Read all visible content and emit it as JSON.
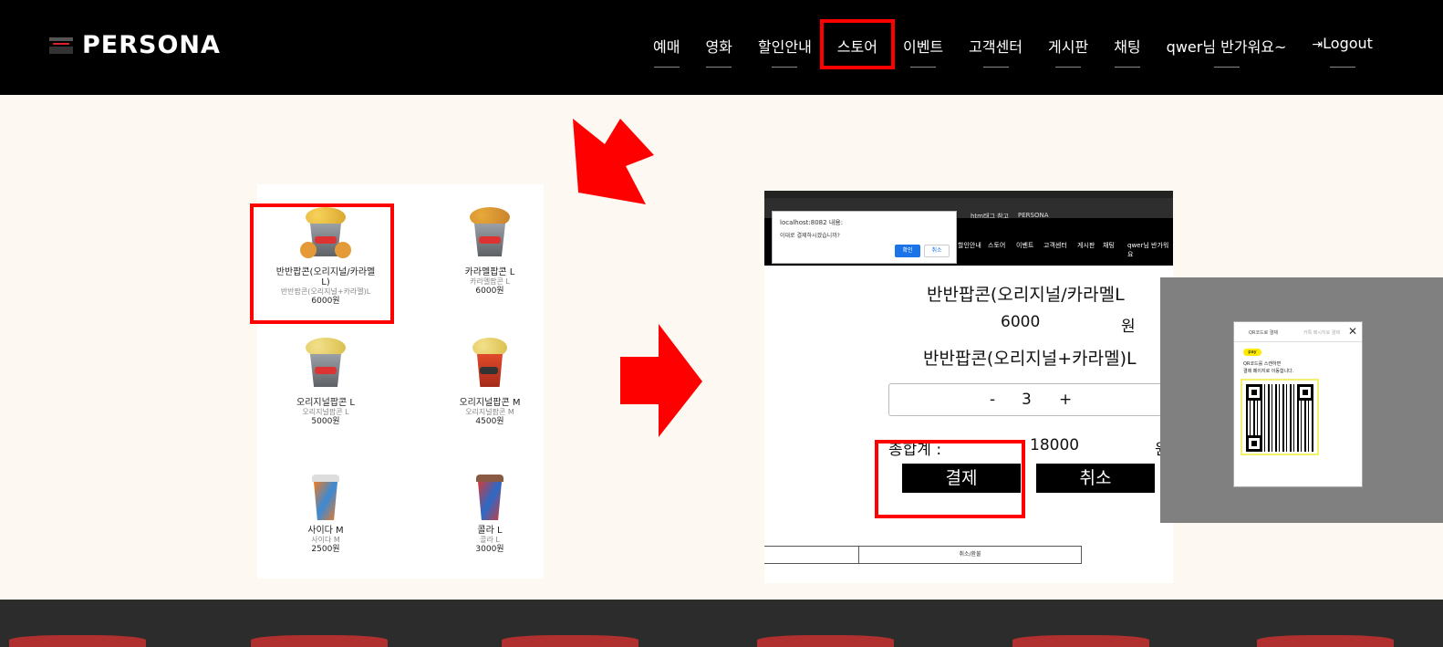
{
  "header": {
    "logo_text": "PERSONA",
    "nav": [
      {
        "label": "예매"
      },
      {
        "label": "영화"
      },
      {
        "label": "할인안내"
      },
      {
        "label": "스토어"
      },
      {
        "label": "이벤트"
      },
      {
        "label": "고객센터"
      },
      {
        "label": "게시판"
      },
      {
        "label": "채팅"
      },
      {
        "label": "qwer님 반가워요~"
      },
      {
        "label": "Logout",
        "icon": "logout-icon"
      }
    ]
  },
  "store": {
    "products": [
      {
        "name": "반반팝콘(오리지널/카라멜L)",
        "desc": "반반팝콘(오리지널+카라멜)L",
        "price": "6000원"
      },
      {
        "name": "카라멜팝콘 L",
        "desc": "카라멜팝콘 L",
        "price": "6000원"
      },
      {
        "name": "오리지널팝콘 L",
        "desc": "오리지널팝콘 L",
        "price": "5000원"
      },
      {
        "name": "오리지널팝콘 M",
        "desc": "오리지널팝콘 M",
        "price": "4500원"
      },
      {
        "name": "사이다 M",
        "desc": "사이다 M",
        "price": "2500원"
      },
      {
        "name": "콜라 L",
        "desc": "콜라 L",
        "price": "3000원"
      }
    ]
  },
  "screenshot": {
    "tab_left": "htm태그 참고",
    "tab_right": "PERSONA",
    "nav": [
      "할인안내",
      "스토어",
      "이벤트",
      "고객센터",
      "게시판",
      "채팅",
      "qwer님 반가워요"
    ],
    "alert": {
      "title": "localhost:8082 내용:",
      "message": "이대로 결제하시겠습니까?",
      "ok": "확인",
      "cancel": "취소"
    },
    "product_title": "반반팝콘(오리지널/카라멜L",
    "price": "6000",
    "won": "원",
    "product_desc": "반반팝콘(오리지널+카라멜)L",
    "stepper": {
      "minus": "-",
      "qty": "3",
      "plus": "+"
    },
    "total_label": "총합계 :",
    "total": "18000",
    "pay_button": "결제",
    "cancel_button": "취소",
    "footer_cell": "취소/환불"
  },
  "qr_popup": {
    "tab_active": "QR코드로 결제",
    "tab_inactive": "카톡 메시지로 결제",
    "close": "✕",
    "kakaopay": "pay",
    "line1": "QR코드를 스캔하면",
    "line2": "결제 페이지로 이동합니다."
  },
  "colors": {
    "highlight": "#ff0000",
    "header_bg": "#000000",
    "page_bg": "#fdf8f2",
    "footer_bg": "#2c2c2c",
    "overlay": "#808080"
  }
}
